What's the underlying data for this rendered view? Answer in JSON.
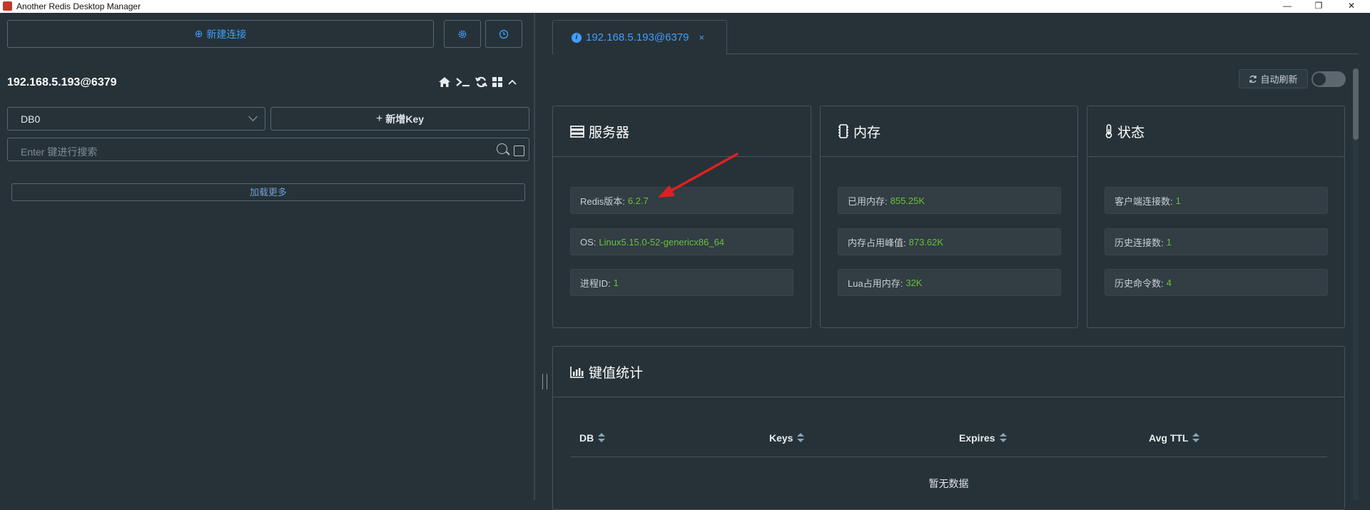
{
  "window": {
    "title": "Another Redis Desktop Manager",
    "minimize": "—",
    "restore": "❐",
    "close": "✕"
  },
  "left": {
    "new_connection": "新建连接",
    "settings_icon": "gear-icon",
    "history_icon": "clock-icon",
    "host": "192.168.5.193@6379",
    "db_select": "DB0",
    "new_key": "新增Key",
    "search_placeholder": "Enter 键进行搜索",
    "load_more": "加载更多"
  },
  "tab": {
    "label": "192.168.5.193@6379",
    "close": "×"
  },
  "auto_refresh": "自动刷新",
  "cards": {
    "server": {
      "title": "服务器",
      "rows": [
        {
          "label": "Redis版本:",
          "value": "6.2.7"
        },
        {
          "label": "OS:",
          "value": "Linux5.15.0-52-genericx86_64"
        },
        {
          "label": "进程ID:",
          "value": "1"
        }
      ]
    },
    "memory": {
      "title": "内存",
      "rows": [
        {
          "label": "已用内存:",
          "value": "855.25K"
        },
        {
          "label": "内存占用峰值:",
          "value": "873.62K"
        },
        {
          "label": "Lua占用内存:",
          "value": "32K"
        }
      ]
    },
    "status": {
      "title": "状态",
      "rows": [
        {
          "label": "客户端连接数:",
          "value": "1"
        },
        {
          "label": "历史连接数:",
          "value": "1"
        },
        {
          "label": "历史命令数:",
          "value": "4"
        }
      ]
    }
  },
  "keystats": {
    "title": "键值统计",
    "columns": [
      "DB",
      "Keys",
      "Expires",
      "Avg TTL"
    ],
    "empty": "暂无数据"
  },
  "colors": {
    "accent": "#409eff",
    "value_green": "#67c23a",
    "annotation_red": "#e02020"
  }
}
